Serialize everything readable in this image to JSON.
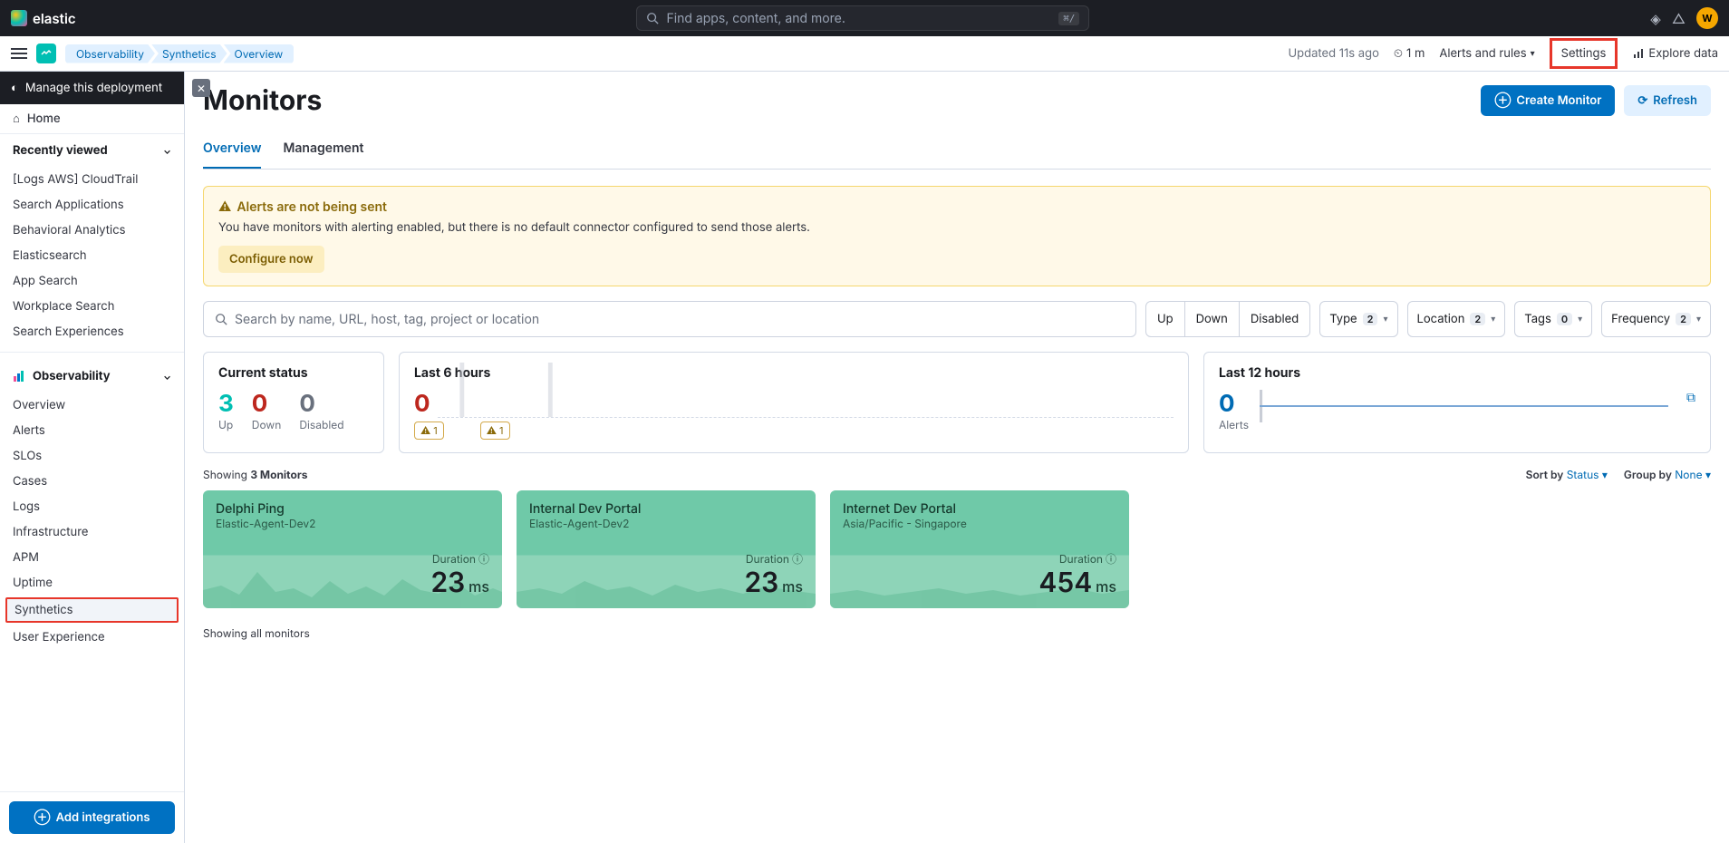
{
  "brand": "elastic",
  "global_search_placeholder": "Find apps, content, and more.",
  "global_search_kbd": "⌘/",
  "avatar_initials": "W",
  "deploy_banner": "Manage this deployment",
  "home_label": "Home",
  "recent_label": "Recently viewed",
  "recent_items": [
    "[Logs AWS] CloudTrail",
    "Search Applications",
    "Behavioral Analytics",
    "Elasticsearch",
    "App Search",
    "Workplace Search",
    "Search Experiences"
  ],
  "obs_header": "Observability",
  "obs_items": [
    "Overview",
    "Alerts",
    "SLOs",
    "Cases",
    "Logs",
    "Infrastructure",
    "APM",
    "Uptime",
    "Synthetics",
    "User Experience"
  ],
  "obs_active": "Synthetics",
  "add_integrations": "Add integrations",
  "breadcrumbs": [
    "Observability",
    "Synthetics",
    "Overview"
  ],
  "updated_text": "Updated 11s ago",
  "refresh_interval": "1 m",
  "alerts_rules": "Alerts and rules",
  "settings_label": "Settings",
  "explore_label": "Explore data",
  "page_title": "Monitors",
  "create_btn": "Create Monitor",
  "refresh_btn": "Refresh",
  "tabs": {
    "overview": "Overview",
    "management": "Management"
  },
  "callout": {
    "title": "Alerts are not being sent",
    "body": "You have monitors with alerting enabled, but there is no default connector configured to send those alerts.",
    "btn": "Configure now"
  },
  "search_placeholder": "Search by name, URL, host, tag, project or location",
  "status_pills": [
    "Up",
    "Down",
    "Disabled"
  ],
  "facets": [
    {
      "label": "Type",
      "count": "2"
    },
    {
      "label": "Location",
      "count": "2"
    },
    {
      "label": "Tags",
      "count": "0"
    },
    {
      "label": "Frequency",
      "count": "2"
    }
  ],
  "current_status_title": "Current status",
  "status_counts": {
    "up": "3",
    "down": "0",
    "disabled": "0",
    "up_lbl": "Up",
    "down_lbl": "Down",
    "disabled_lbl": "Disabled"
  },
  "last6_title": "Last 6 hours",
  "last6_zero": "0",
  "last6_pills": [
    "1",
    "1"
  ],
  "last12_title": "Last 12 hours",
  "last12_num": "0",
  "last12_lbl": "Alerts",
  "showing_prefix": "Showing ",
  "showing_bold": "3 Monitors",
  "sort_by_lbl": "Sort by",
  "sort_by_val": "Status",
  "group_by_lbl": "Group by",
  "group_by_val": "None",
  "monitors": [
    {
      "name": "Delphi Ping",
      "loc": "Elastic-Agent-Dev2",
      "dur": "23",
      "unit": "ms"
    },
    {
      "name": "Internal Dev Portal",
      "loc": "Elastic-Agent-Dev2",
      "dur": "23",
      "unit": "ms"
    },
    {
      "name": "Internet Dev Portal",
      "loc": "Asia/Pacific - Singapore",
      "dur": "454",
      "unit": "ms"
    }
  ],
  "footer": "Showing all monitors",
  "duration_label": "Duration"
}
